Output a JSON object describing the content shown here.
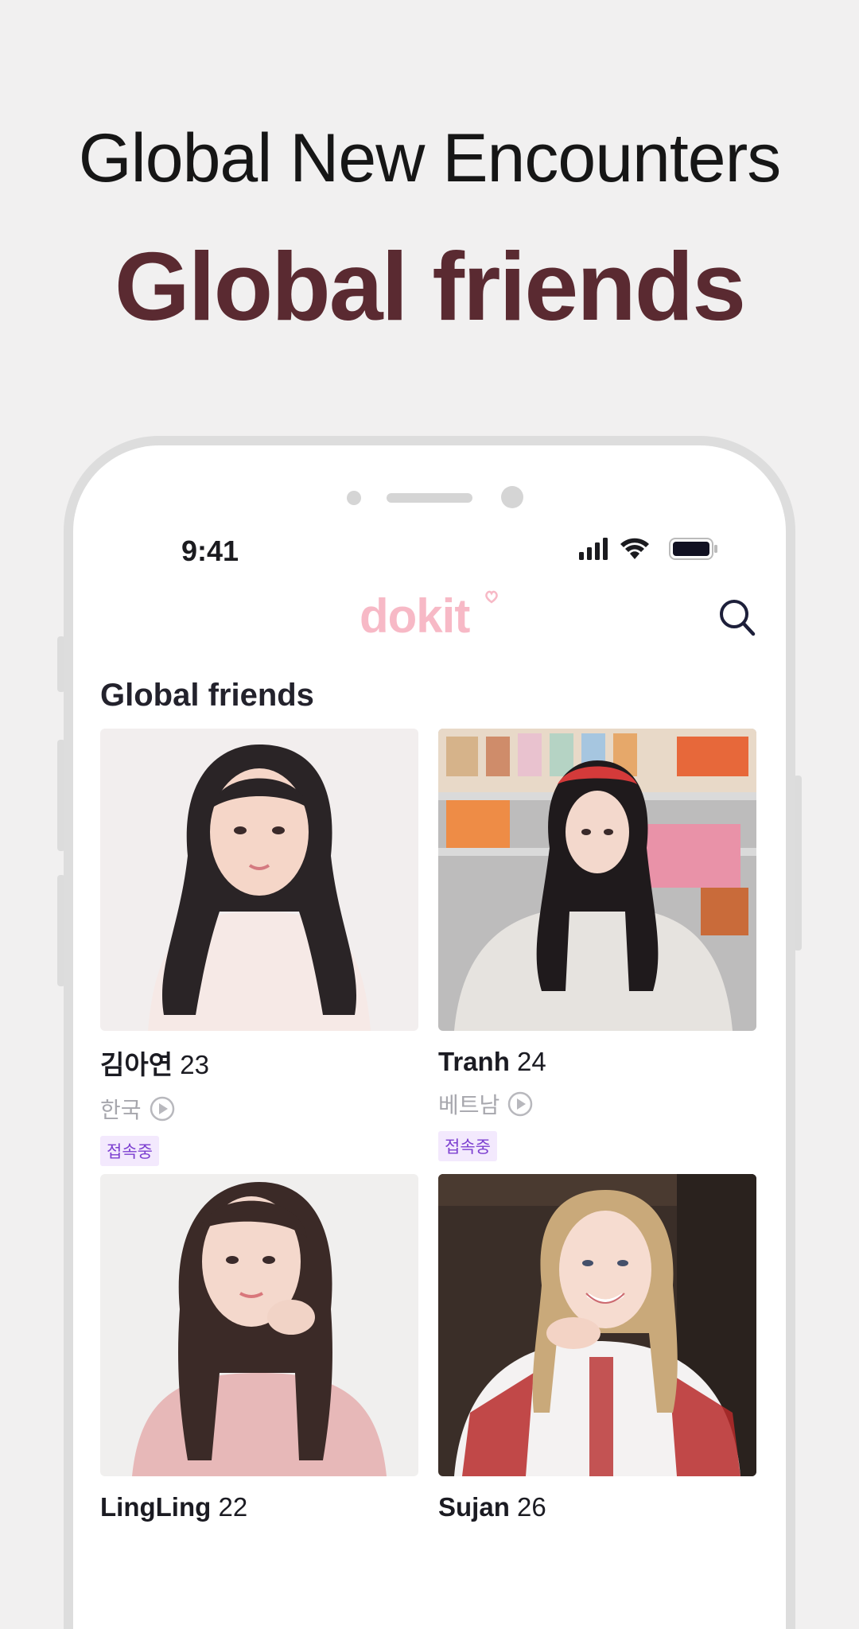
{
  "promo": {
    "headline": "Global New Encounters",
    "subheadline": "Global friends"
  },
  "status_bar": {
    "time": "9:41"
  },
  "app": {
    "logo_text": "dokit",
    "section_title": "Global friends",
    "colors": {
      "logo": "#f7b9c6",
      "title_brand": "#5a2a31",
      "badge_bg": "#f3e9fd",
      "badge_text": "#7c3fd0"
    }
  },
  "friends": [
    {
      "name": "김아연",
      "age": "23",
      "country": "한국",
      "status": "접속중"
    },
    {
      "name": "Tranh",
      "age": "24",
      "country": "베트남",
      "status": "접속중"
    },
    {
      "name": "LingLing",
      "age": "22"
    },
    {
      "name": "Sujan",
      "age": "26"
    }
  ],
  "icons": {
    "search": "search-icon",
    "play": "play-circle-icon",
    "signal": "cellular-signal-icon",
    "wifi": "wifi-icon",
    "battery": "battery-icon"
  }
}
